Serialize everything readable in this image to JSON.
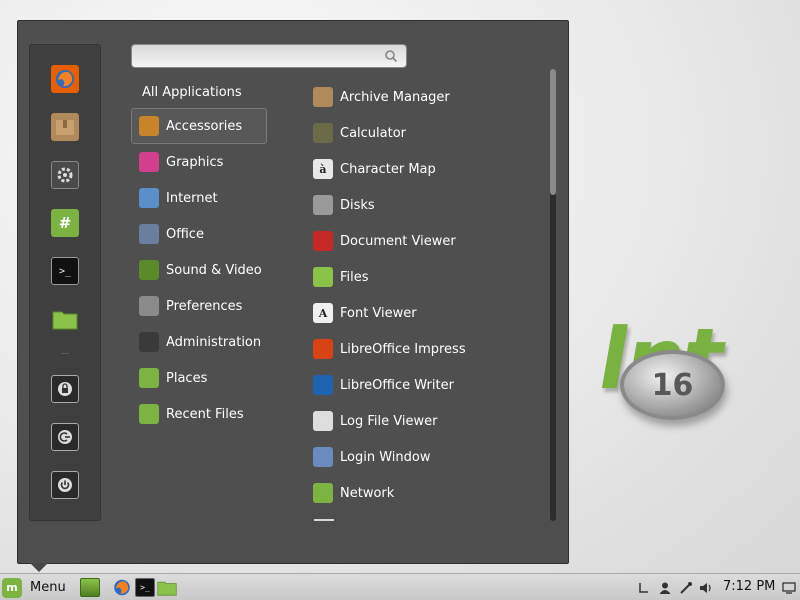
{
  "desktop": {
    "wallpaper_text": "lnt",
    "wallpaper_badge": "16"
  },
  "menu": {
    "search": {
      "value": "",
      "placeholder": ""
    },
    "favorites": [
      {
        "name": "firefox-icon",
        "color": "#e66000"
      },
      {
        "name": "archive-manager-icon",
        "color": "#b08a5a"
      },
      {
        "name": "system-settings-icon",
        "color": "#4a4a4a"
      },
      {
        "name": "hexchat-icon",
        "color": "#7cb342"
      },
      {
        "name": "terminal-icon",
        "color": "#111111"
      },
      {
        "name": "files-folder-icon",
        "color": "#8bc34a"
      },
      {
        "name": "lock-screen-icon",
        "color": "#2a2a2a"
      },
      {
        "name": "logout-icon",
        "color": "#2a2a2a"
      },
      {
        "name": "shutdown-icon",
        "color": "#2a2a2a"
      }
    ],
    "all_applications_label": "All Applications",
    "categories": [
      {
        "label": "Accessories",
        "icon": "accessories-icon",
        "color": "#c8842a",
        "selected": true
      },
      {
        "label": "Graphics",
        "icon": "graphics-icon",
        "color": "#d33f8f"
      },
      {
        "label": "Internet",
        "icon": "internet-icon",
        "color": "#5b8fc9"
      },
      {
        "label": "Office",
        "icon": "office-icon",
        "color": "#6a7fa0"
      },
      {
        "label": "Sound & Video",
        "icon": "sound-video-icon",
        "color": "#5a8a2a"
      },
      {
        "label": "Preferences",
        "icon": "preferences-icon",
        "color": "#8a8a8a"
      },
      {
        "label": "Administration",
        "icon": "administration-icon",
        "color": "#3a3a3a"
      },
      {
        "label": "Places",
        "icon": "places-icon",
        "color": "#7cb342"
      },
      {
        "label": "Recent Files",
        "icon": "recent-files-icon",
        "color": "#7cb342"
      }
    ],
    "applications": [
      {
        "label": "Archive Manager",
        "icon": "archive-manager-icon",
        "color": "#b08a5a"
      },
      {
        "label": "Calculator",
        "icon": "calculator-icon",
        "color": "#6b6b4a"
      },
      {
        "label": "Character Map",
        "icon": "character-map-icon",
        "color": "#e8e8e8",
        "glyph": "à"
      },
      {
        "label": "Disks",
        "icon": "disks-icon",
        "color": "#9a9a9a"
      },
      {
        "label": "Document Viewer",
        "icon": "document-viewer-icon",
        "color": "#c62828"
      },
      {
        "label": "Files",
        "icon": "files-icon",
        "color": "#8bc34a"
      },
      {
        "label": "Font Viewer",
        "icon": "font-viewer-icon",
        "color": "#f0f0f0",
        "glyph": "A"
      },
      {
        "label": "LibreOffice Impress",
        "icon": "libreoffice-impress-icon",
        "color": "#d84315"
      },
      {
        "label": "LibreOffice Writer",
        "icon": "libreoffice-writer-icon",
        "color": "#1e63b0"
      },
      {
        "label": "Log File Viewer",
        "icon": "log-file-viewer-icon",
        "color": "#dddddd"
      },
      {
        "label": "Login Window",
        "icon": "login-window-icon",
        "color": "#6a8ac0"
      },
      {
        "label": "Network",
        "icon": "network-icon",
        "color": "#7cb342"
      }
    ]
  },
  "panel": {
    "menu_label": "Menu",
    "launchers": [
      {
        "name": "show-desktop-icon",
        "color": "#6a9a3a"
      },
      {
        "name": "firefox-icon",
        "color": "#e66000"
      },
      {
        "name": "terminal-icon",
        "color": "#111111"
      },
      {
        "name": "files-folder-icon",
        "color": "#8bc34a"
      }
    ],
    "tray": [
      "keyboard-icon",
      "user-icon",
      "network-icon",
      "volume-icon"
    ],
    "clock": "7:12 PM"
  }
}
